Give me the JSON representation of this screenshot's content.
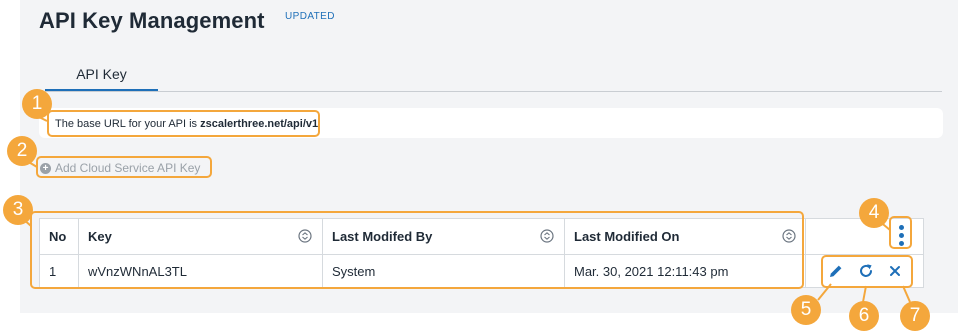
{
  "page": {
    "title": "API Key Management",
    "badge": "UPDATED"
  },
  "tabs": [
    {
      "label": "API Key",
      "active": true
    }
  ],
  "base_url": {
    "prefix": "The base URL for your API is ",
    "value": "zscalerthree.net/api/v1"
  },
  "add_link": {
    "icon": "plus-circle-icon",
    "label": "Add Cloud Service API Key"
  },
  "table": {
    "columns": [
      "No",
      "Key",
      "Last Modifed By",
      "Last Modified On"
    ],
    "rows": [
      {
        "no": "1",
        "key": "wVnzWNnAL3TL",
        "modified_by": "System",
        "modified_on": "Mar. 30, 2021 12:11:43 pm"
      }
    ]
  },
  "row_actions": {
    "edit_icon": "pencil-icon",
    "regenerate_icon": "refresh-icon",
    "delete_icon": "close-icon"
  },
  "callouts": [
    "1",
    "2",
    "3",
    "4",
    "5",
    "6",
    "7"
  ],
  "colors": {
    "accent": "#1e6fb8",
    "callout": "#f4a73c",
    "panel_bg": "#f3f4f6"
  }
}
